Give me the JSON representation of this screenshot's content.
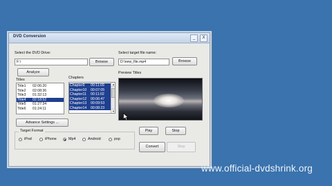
{
  "window": {
    "title": "DVD Conversion",
    "minimize": "_",
    "close": "X"
  },
  "drive": {
    "label": "Select the DVD Drive:",
    "value": "F:\\",
    "browse": "Browse",
    "analyze": "Analyze"
  },
  "target": {
    "label": "Select target file name:",
    "value": "D:\\new_file.mp4",
    "browse": "Browse"
  },
  "titles": {
    "label": "Titles",
    "items": [
      {
        "name": "Title1",
        "time": "02:06:20"
      },
      {
        "name": "Title2",
        "time": "02:08:36"
      },
      {
        "name": "Title3",
        "time": "01:32:13"
      },
      {
        "name": "Title4",
        "time": "02:18:52"
      },
      {
        "name": "Title5",
        "time": "01:27:34"
      },
      {
        "name": "Title6",
        "time": "01:24:11"
      }
    ],
    "selected_index": 3
  },
  "chapters": {
    "label": "Chapters",
    "items": [
      {
        "name": "Chapter9",
        "time": "00:11:09"
      },
      {
        "name": "Chapter10",
        "time": "00:07:05"
      },
      {
        "name": "Chapter11",
        "time": "00:11:02"
      },
      {
        "name": "Chapter12",
        "time": "00:06:47"
      },
      {
        "name": "Chapter13",
        "time": "00:09:53"
      },
      {
        "name": "Chapter14",
        "time": "00:08:23"
      }
    ]
  },
  "advance_settings": "Advance Settings ...",
  "preview": {
    "label": "Preview Titles",
    "play": "Play",
    "stop": "Stop"
  },
  "format": {
    "label": "Target Format",
    "options": [
      "iPod",
      "iPhone",
      "Mp4",
      "Android",
      "psp"
    ],
    "selected": "Mp4"
  },
  "actions": {
    "convert": "Convert",
    "stop": "Stop"
  },
  "watermark": "www.official-dvdshrink.org",
  "colors": {
    "desktop": "#3a73ad",
    "selection": "#1f3f8f"
  }
}
